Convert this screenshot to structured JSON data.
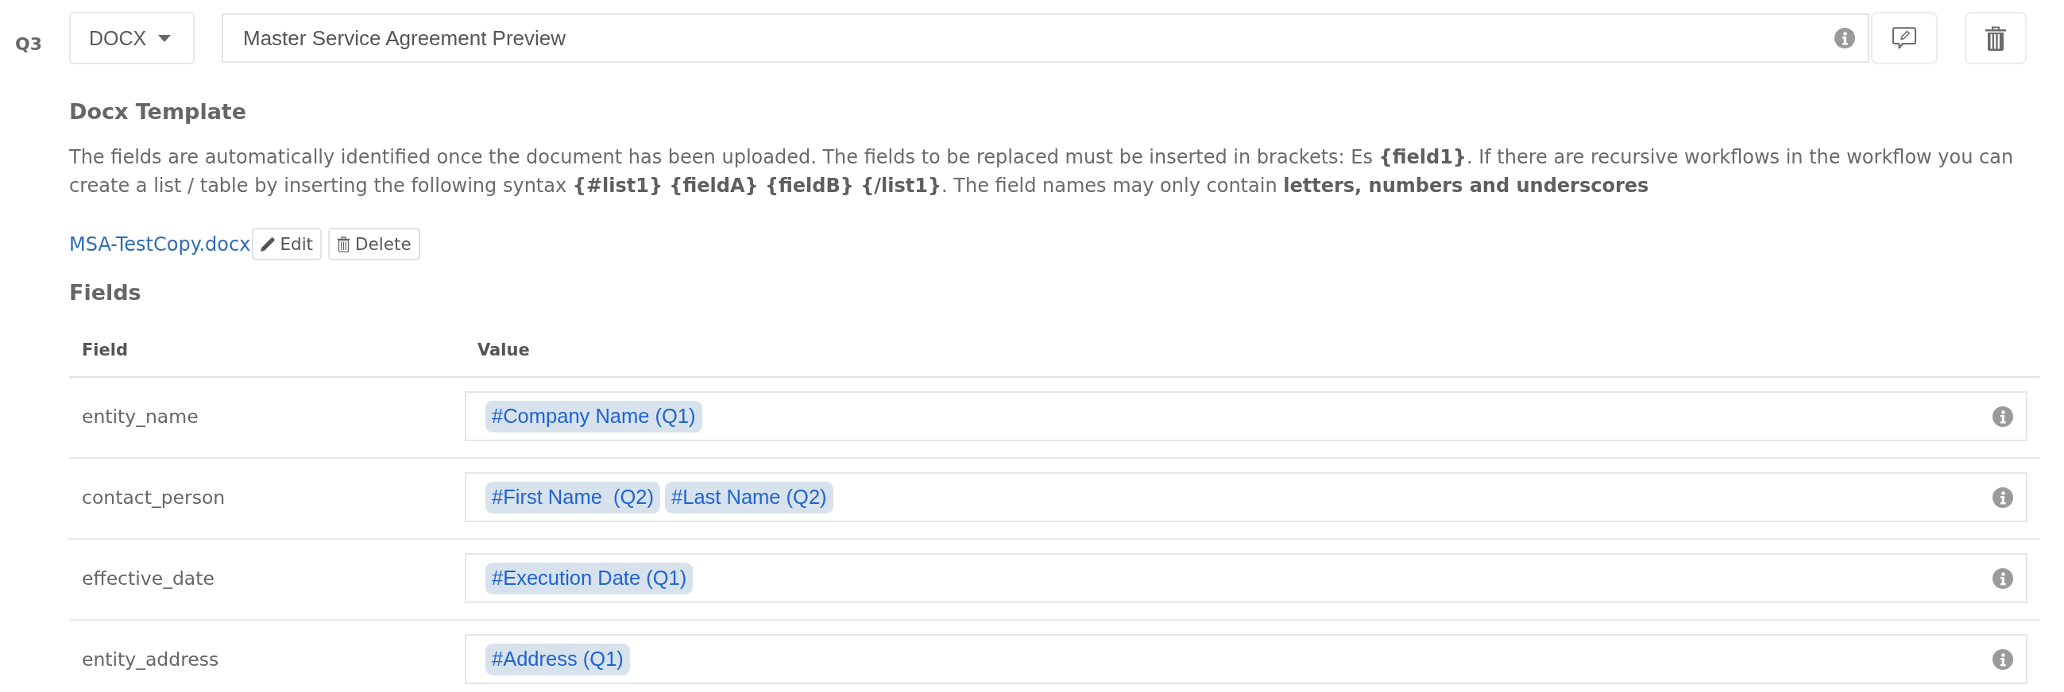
{
  "question": {
    "label": "Q3",
    "format": "DOCX",
    "title_value": "Master Service Agreement Preview"
  },
  "template": {
    "heading": "Docx Template",
    "description": "The fields are automatically identified once the document has been uploaded. The fields to be replaced must be inserted in brackets: Es **{field1}**. If there are recursive workflows in the workflow you can create a list / table by inserting the following syntax **{#list1} {fieldA} {fieldB} {/list1}**. The field names may only contain **letters, numbers and underscores**",
    "file": {
      "name": "MSA-TestCopy.docx",
      "buttons": [
        {
          "label": "Edit",
          "kind": "edit"
        },
        {
          "label": "Delete",
          "kind": "delete"
        }
      ]
    }
  },
  "fields": {
    "heading": "Fields",
    "columns": [
      "Field",
      "Value"
    ],
    "rows": [
      {
        "field": "entity_name",
        "tags": [
          "#Company Name (Q1)"
        ]
      },
      {
        "field": "contact_person",
        "tags": [
          "#First Name  (Q2)",
          "#Last Name (Q2)"
        ]
      },
      {
        "field": "effective_date",
        "tags": [
          "#Execution Date (Q1)"
        ]
      },
      {
        "field": "entity_address",
        "tags": [
          "#Address (Q1)"
        ]
      }
    ]
  }
}
